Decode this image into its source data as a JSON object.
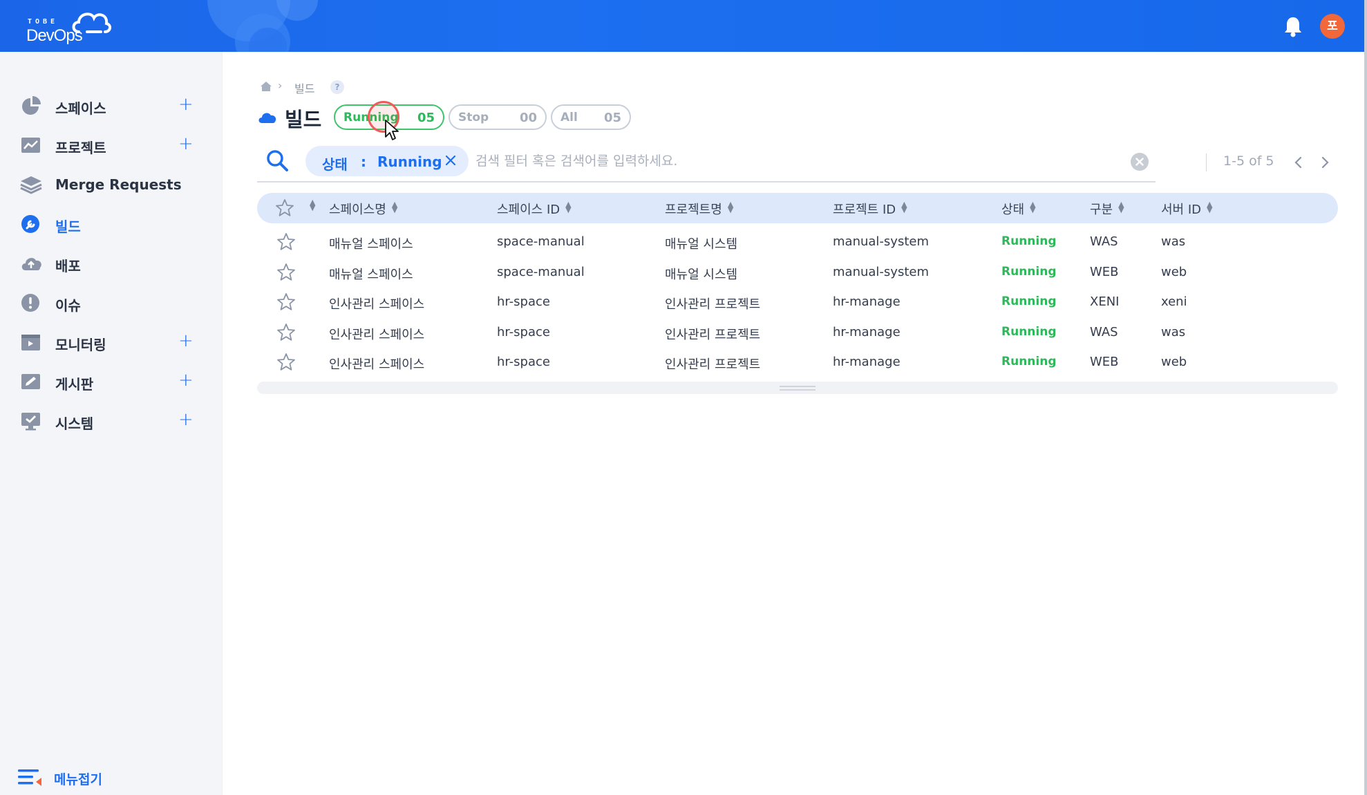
{
  "header": {
    "logo_top": "TOBE",
    "logo_main": "DevOps",
    "bell_icon": "bell-icon",
    "avatar_initial": "포",
    "accent": "#1b66e8",
    "avatar_color": "#f2683a"
  },
  "sidebar": {
    "items": [
      {
        "label": "스페이스",
        "icon": "pie-chart-icon",
        "has_plus": true,
        "active": false
      },
      {
        "label": "프로젝트",
        "icon": "chart-board-icon",
        "has_plus": true,
        "active": false
      },
      {
        "label": "Merge Requests",
        "icon": "layers-icon",
        "has_plus": false,
        "active": false
      },
      {
        "label": "빌드",
        "icon": "wrench-icon",
        "has_plus": false,
        "active": true
      },
      {
        "label": "배포",
        "icon": "cloud-upload-icon",
        "has_plus": false,
        "active": false
      },
      {
        "label": "이슈",
        "icon": "alert-icon",
        "has_plus": false,
        "active": false
      },
      {
        "label": "모니터링",
        "icon": "monitor-window-icon",
        "has_plus": true,
        "active": false
      },
      {
        "label": "게시판",
        "icon": "edit-board-icon",
        "has_plus": true,
        "active": false
      },
      {
        "label": "시스템",
        "icon": "desktop-check-icon",
        "has_plus": true,
        "active": false
      }
    ],
    "plus_symbol": "+",
    "collapse_label": "메뉴접기"
  },
  "breadcrumb": {
    "current": "빌드",
    "separator": "›",
    "help": "?"
  },
  "page": {
    "title": "빌드"
  },
  "filters": [
    {
      "label": "Running",
      "count": "05",
      "selected": true
    },
    {
      "label": "Stop",
      "count": "00",
      "selected": false
    },
    {
      "label": "All",
      "count": "05",
      "selected": false
    }
  ],
  "search": {
    "chip_key": "상태",
    "chip_sep": ":",
    "chip_value": "Running",
    "placeholder": "검색 필터 혹은 검색어를 입력하세요.",
    "value": ""
  },
  "pagination": {
    "text": "1-5 of 5"
  },
  "table": {
    "headers": [
      "스페이스명",
      "스페이스 ID",
      "프로젝트명",
      "프로젝트 ID",
      "상태",
      "구분",
      "서버 ID"
    ],
    "rows": [
      [
        "매뉴얼 스페이스",
        "space-manual",
        "매뉴얼 시스템",
        "manual-system",
        "Running",
        "WAS",
        "was"
      ],
      [
        "매뉴얼 스페이스",
        "space-manual",
        "매뉴얼 시스템",
        "manual-system",
        "Running",
        "WEB",
        "web"
      ],
      [
        "인사관리 스페이스",
        "hr-space",
        "인사관리 프로젝트",
        "hr-manage",
        "Running",
        "XENI",
        "xeni"
      ],
      [
        "인사관리 스페이스",
        "hr-space",
        "인사관리 프로젝트",
        "hr-manage",
        "Running",
        "WAS",
        "was"
      ],
      [
        "인사관리 스페이스",
        "hr-space",
        "인사관리 프로젝트",
        "hr-manage",
        "Running",
        "WEB",
        "web"
      ]
    ],
    "status_color": "#2db85a"
  }
}
